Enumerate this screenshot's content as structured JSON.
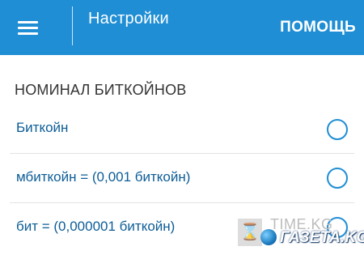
{
  "header": {
    "menu_icon": "hamburger-menu-icon",
    "title": "Настройки",
    "help_label": "ПОМОЩЬ",
    "background_color": "#1f8ed4"
  },
  "section": {
    "title": "НОМИНАЛ БИТКОЙНОВ",
    "options": [
      {
        "label": "Биткойн",
        "selected": false
      },
      {
        "label": "мбиткойн = (0,001 биткойн)",
        "selected": false
      },
      {
        "label": "бит = (0,000001 биткойн)",
        "selected": false
      }
    ]
  },
  "watermark": {
    "time_text": "TIME.KG",
    "gazeta_text": "ГАЗЕТА.KG"
  },
  "colors": {
    "accent": "#1f8ed4",
    "option_text": "#0d5d97",
    "header_text": "#333333"
  }
}
